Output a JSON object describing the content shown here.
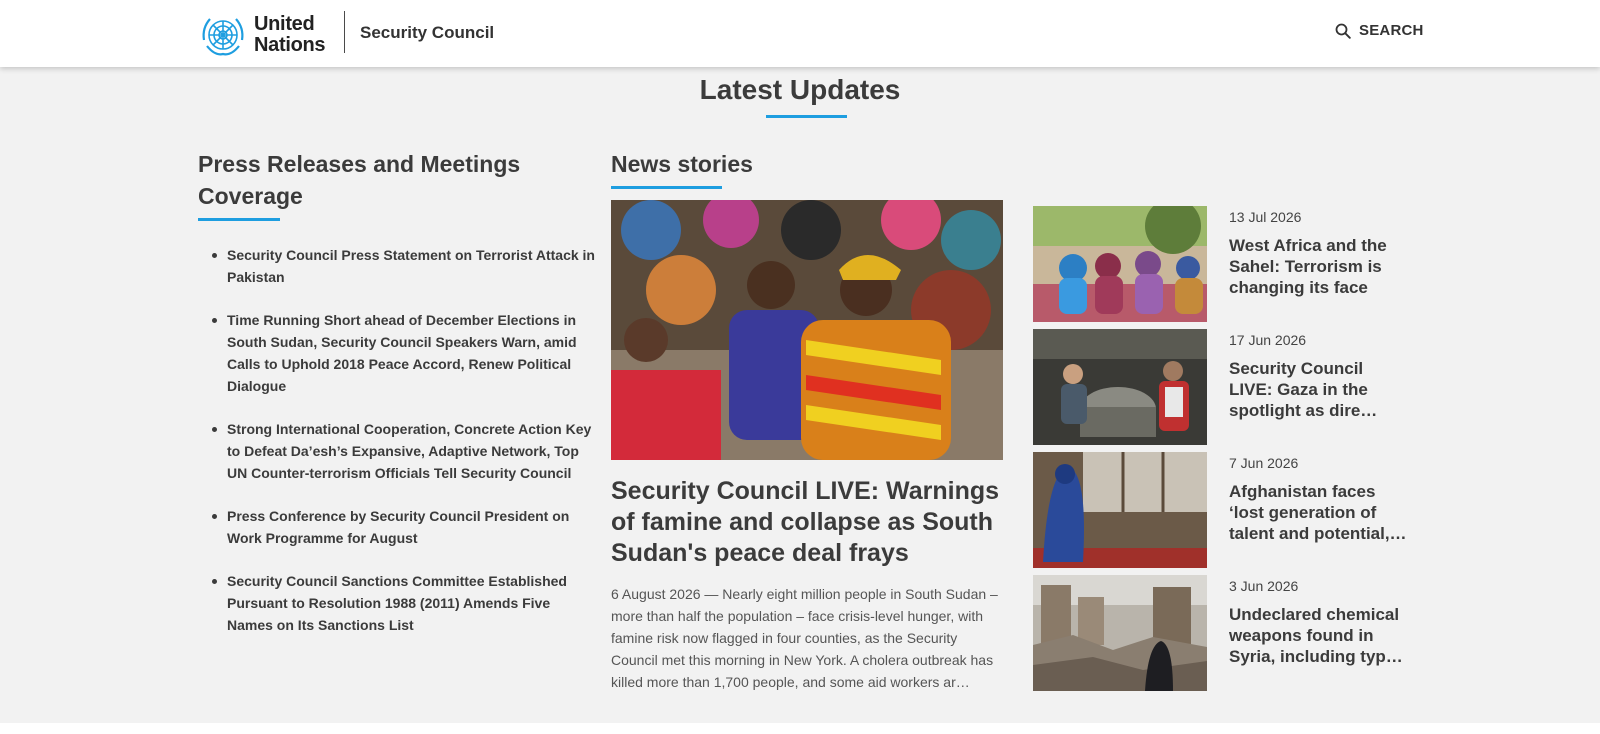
{
  "header": {
    "logo_line1": "United",
    "logo_line2": "Nations",
    "section": "Security Council",
    "search_label": "SEARCH",
    "brand_color": "#1e9ee0"
  },
  "page": {
    "title": "Latest Updates"
  },
  "press": {
    "title": "Press Releases and Meetings Coverage",
    "items": [
      "Security Council Press Statement on Terrorist Attack in Pakistan",
      "Time Running Short ahead of December Elections in South Sudan, Security Council Speakers Warn, amid Calls to Uphold 2018 Peace Accord, Renew Political Dialogue",
      "Strong International Cooperation, Concrete Action Key to Defeat Da’esh’s Expansive, Adaptive Network, Top UN Counter-terrorism Officials Tell Security Council",
      "Press Conference by Security Council President on Work Programme for August",
      "Security Council Sanctions Committee Established Pursuant to Resolution 1988 (2011) Amends Five Names on Its Sanctions List"
    ]
  },
  "news": {
    "title": "News stories",
    "hero": {
      "title": "Security Council LIVE: Warnings of famine and collapse as South Sudan's peace deal frays",
      "summary": "6 August 2026 — Nearly eight million people in South Sudan – more than half the population – face crisis-level hunger, with famine risk now flagged in four counties, as the Security Council met this morning in New York. A cholera outbreak has killed more than 1,700 people, and some aid workers ar…"
    },
    "stories": [
      {
        "date": "13 Jul 2026",
        "title": "West Africa and the Sahel: Terrorism is changing its face"
      },
      {
        "date": "17 Jun 2026",
        "title": "Security Council LIVE: Gaza in the spotlight as dire…"
      },
      {
        "date": "7 Jun 2026",
        "title": "Afghanistan faces ‘lost generation of talent and potential,…"
      },
      {
        "date": "3 Jun 2026",
        "title": "Undeclared chemical weapons found in Syria, including typ…"
      }
    ]
  }
}
